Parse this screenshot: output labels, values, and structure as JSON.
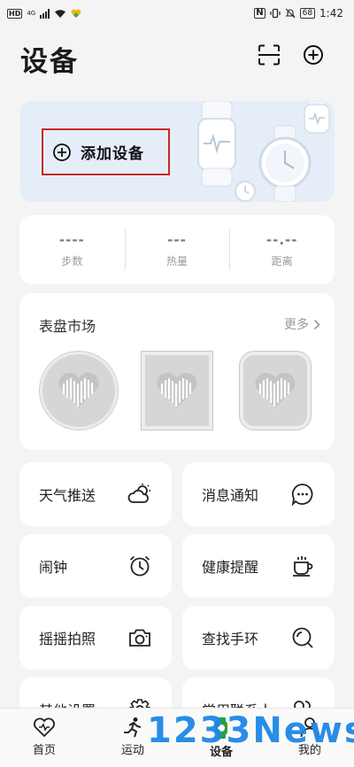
{
  "status_bar": {
    "hd": "HD",
    "network": "4G",
    "battery": "68",
    "time": "1:42"
  },
  "header": {
    "title": "设备",
    "scan_icon": "scan-icon",
    "add_icon": "plus-circle-icon"
  },
  "banner": {
    "add_device_label": "添加设备"
  },
  "stats": [
    {
      "value": "----",
      "label": "步数"
    },
    {
      "value": "---",
      "label": "热量"
    },
    {
      "value": "--.--",
      "label": "距离"
    }
  ],
  "watch_faces": {
    "title": "表盘市场",
    "more_label": "更多"
  },
  "features": [
    {
      "label": "天气推送",
      "icon": "weather-icon"
    },
    {
      "label": "消息通知",
      "icon": "message-icon"
    },
    {
      "label": "闹钟",
      "icon": "alarm-clock-icon"
    },
    {
      "label": "健康提醒",
      "icon": "coffee-cup-icon"
    },
    {
      "label": "摇摇拍照",
      "icon": "camera-icon"
    },
    {
      "label": "查找手环",
      "icon": "search-icon"
    },
    {
      "label": "其他设置",
      "icon": "settings-gear-icon"
    },
    {
      "label": "常用联系人",
      "icon": "contacts-icon"
    }
  ],
  "bottom_nav": [
    {
      "label": "首页",
      "icon": "heart-icon"
    },
    {
      "label": "运动",
      "icon": "running-icon"
    },
    {
      "label": "设备",
      "icon": "watch-icon",
      "active": true
    },
    {
      "label": "我的",
      "icon": "person-icon"
    }
  ],
  "watermark": "1233News",
  "colors": {
    "highlight_border": "#c62828",
    "banner_bg": "#e5eef8",
    "active_nav": "#2e9d3a",
    "watermark": "#1e88e5"
  }
}
